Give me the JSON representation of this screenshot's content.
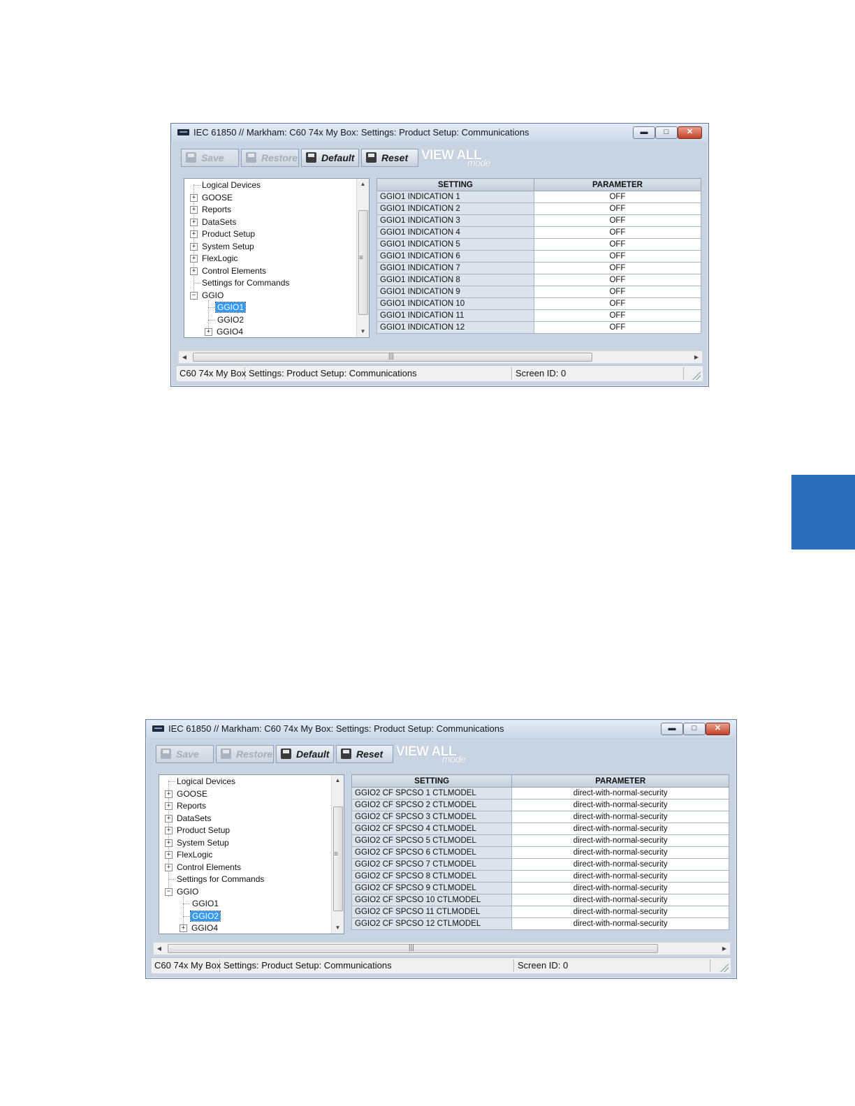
{
  "accent_color": "#2a6ebb",
  "windows": [
    {
      "title": "IEC 61850 // Markham: C60 74x My Box: Settings: Product Setup: Communications",
      "icons": {
        "minimize": "minimize-icon",
        "maximize": "maximize-icon",
        "close": "close-icon",
        "app": "app-window-icon"
      },
      "toolbar": {
        "save": "Save",
        "restore": "Restore",
        "default": "Default",
        "reset": "Reset",
        "view_all": "VIEW ALL",
        "mode": "mode"
      },
      "tree": {
        "items": [
          "Logical Devices",
          "GOOSE",
          "Reports",
          "DataSets",
          "Product Setup",
          "System Setup",
          "FlexLogic",
          "Control Elements",
          "Settings for Commands",
          "GGIO",
          "GGIO1",
          "GGIO2",
          "GGIO4"
        ],
        "selected": "GGIO1"
      },
      "table": {
        "headers": [
          "SETTING",
          "PARAMETER"
        ],
        "rows": [
          [
            "GGIO1 INDICATION 1",
            "OFF"
          ],
          [
            "GGIO1 INDICATION 2",
            "OFF"
          ],
          [
            "GGIO1 INDICATION 3",
            "OFF"
          ],
          [
            "GGIO1 INDICATION 4",
            "OFF"
          ],
          [
            "GGIO1 INDICATION 5",
            "OFF"
          ],
          [
            "GGIO1 INDICATION 6",
            "OFF"
          ],
          [
            "GGIO1 INDICATION 7",
            "OFF"
          ],
          [
            "GGIO1 INDICATION 8",
            "OFF"
          ],
          [
            "GGIO1 INDICATION 9",
            "OFF"
          ],
          [
            "GGIO1 INDICATION 10",
            "OFF"
          ],
          [
            "GGIO1 INDICATION 11",
            "OFF"
          ],
          [
            "GGIO1 INDICATION 12",
            "OFF"
          ]
        ]
      },
      "status": {
        "device": "C60 74x My Box",
        "path": "Settings: Product Setup: Communications",
        "screen_id": "Screen ID: 0"
      }
    },
    {
      "title": "IEC 61850 // Markham: C60 74x My Box: Settings: Product Setup: Communications",
      "icons": {
        "minimize": "minimize-icon",
        "maximize": "maximize-icon",
        "close": "close-icon",
        "app": "app-window-icon"
      },
      "toolbar": {
        "save": "Save",
        "restore": "Restore",
        "default": "Default",
        "reset": "Reset",
        "view_all": "VIEW ALL",
        "mode": "mode"
      },
      "tree": {
        "items": [
          "Logical Devices",
          "GOOSE",
          "Reports",
          "DataSets",
          "Product Setup",
          "System Setup",
          "FlexLogic",
          "Control Elements",
          "Settings for Commands",
          "GGIO",
          "GGIO1",
          "GGIO2",
          "GGIO4"
        ],
        "selected": "GGIO2"
      },
      "table": {
        "headers": [
          "SETTING",
          "PARAMETER"
        ],
        "rows": [
          [
            "GGIO2 CF SPCSO 1 CTLMODEL",
            "direct-with-normal-security"
          ],
          [
            "GGIO2 CF SPCSO 2 CTLMODEL",
            "direct-with-normal-security"
          ],
          [
            "GGIO2 CF SPCSO 3 CTLMODEL",
            "direct-with-normal-security"
          ],
          [
            "GGIO2 CF SPCSO 4 CTLMODEL",
            "direct-with-normal-security"
          ],
          [
            "GGIO2 CF SPCSO 5 CTLMODEL",
            "direct-with-normal-security"
          ],
          [
            "GGIO2 CF SPCSO 6 CTLMODEL",
            "direct-with-normal-security"
          ],
          [
            "GGIO2 CF SPCSO 7 CTLMODEL",
            "direct-with-normal-security"
          ],
          [
            "GGIO2 CF SPCSO 8 CTLMODEL",
            "direct-with-normal-security"
          ],
          [
            "GGIO2 CF SPCSO 9 CTLMODEL",
            "direct-with-normal-security"
          ],
          [
            "GGIO2 CF SPCSO 10 CTLMODEL",
            "direct-with-normal-security"
          ],
          [
            "GGIO2 CF SPCSO 11 CTLMODEL",
            "direct-with-normal-security"
          ],
          [
            "GGIO2 CF SPCSO 12 CTLMODEL",
            "direct-with-normal-security"
          ]
        ]
      },
      "status": {
        "device": "C60 74x My Box",
        "path": "Settings: Product Setup: Communications",
        "screen_id": "Screen ID: 0"
      }
    }
  ]
}
